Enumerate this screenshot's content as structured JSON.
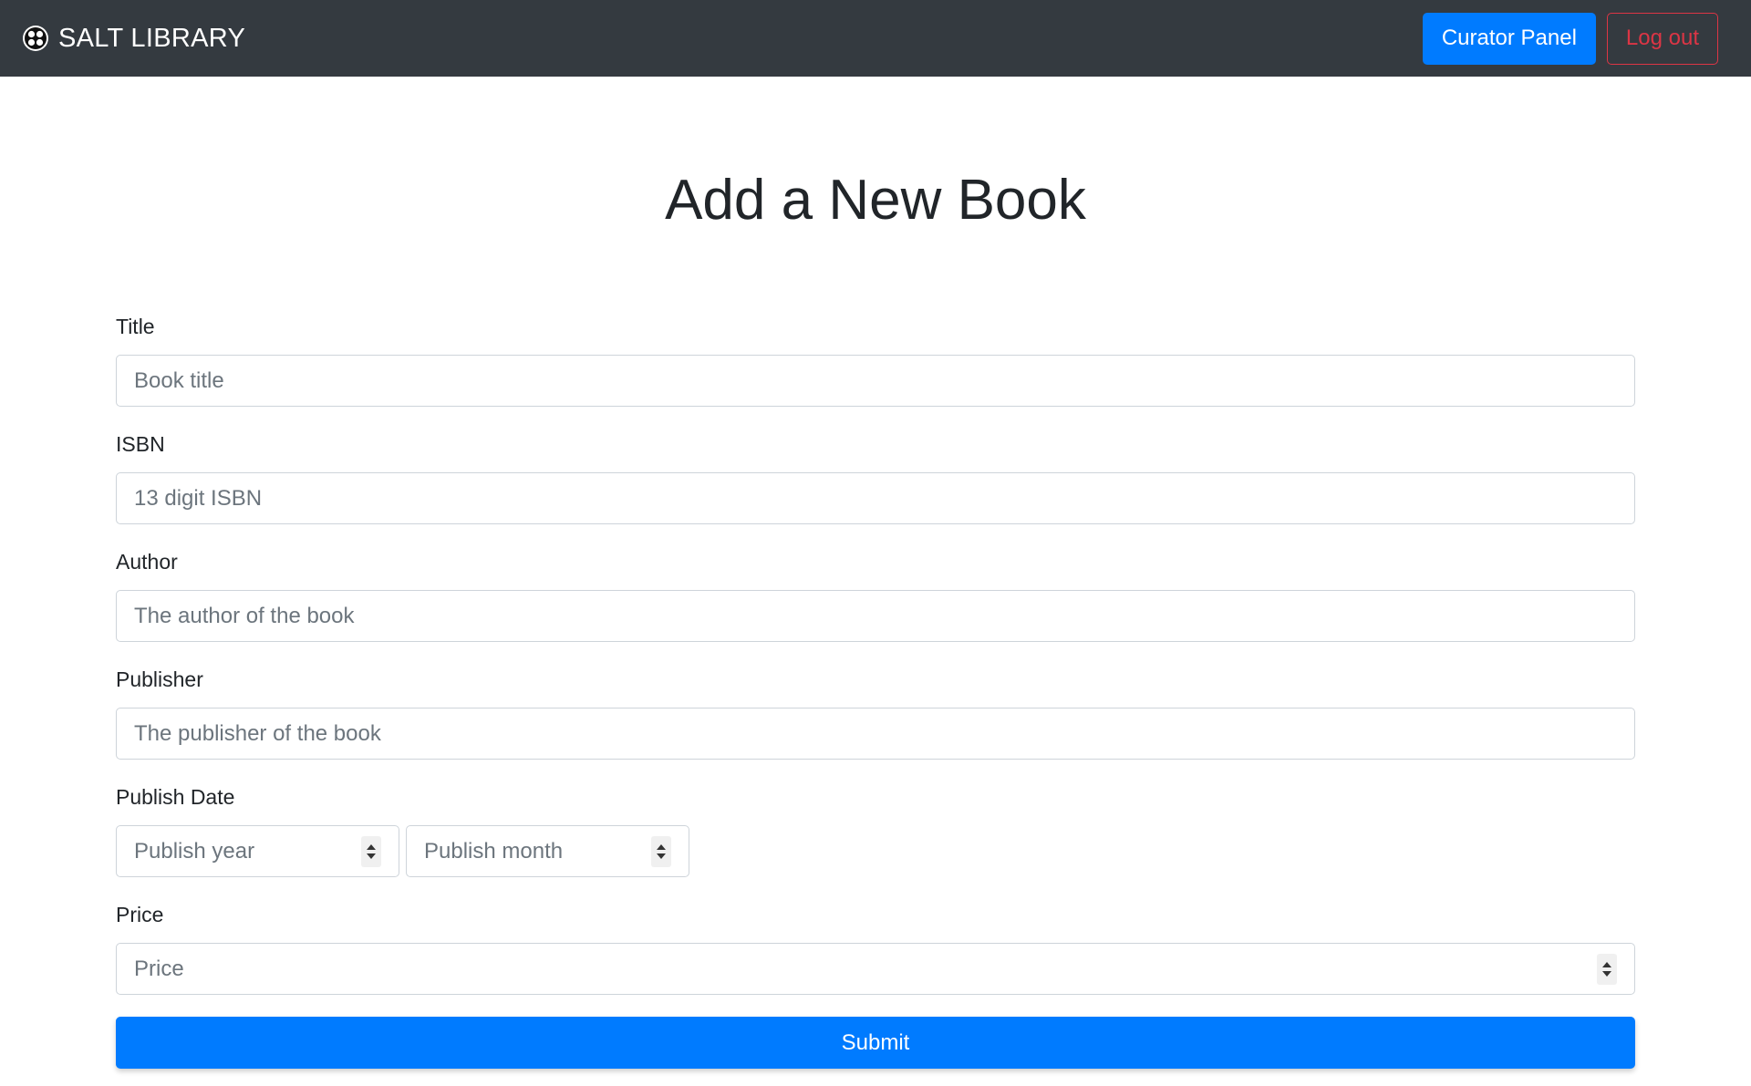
{
  "navbar": {
    "brand_text": "SALT LIBRARY",
    "brand_icon": "salt-logo-icon",
    "curator_label": "Curator Panel",
    "logout_label": "Log out"
  },
  "page": {
    "title": "Add a New Book"
  },
  "form": {
    "title": {
      "label": "Title",
      "placeholder": "Book title"
    },
    "isbn": {
      "label": "ISBN",
      "placeholder": "13 digit ISBN"
    },
    "author": {
      "label": "Author",
      "placeholder": "The author of the book"
    },
    "publisher": {
      "label": "Publisher",
      "placeholder": "The publisher of the book"
    },
    "publish_date": {
      "label": "Publish Date",
      "year_placeholder": "Publish year",
      "month_placeholder": "Publish month"
    },
    "price": {
      "label": "Price",
      "placeholder": "Price"
    },
    "submit_label": "Submit"
  },
  "colors": {
    "navbar_bg": "#343a40",
    "primary": "#007bff",
    "danger": "#dc3545"
  }
}
